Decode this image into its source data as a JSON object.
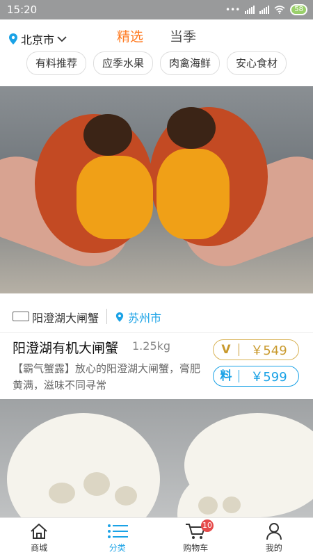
{
  "status_bar": {
    "time": "15:20",
    "battery": "58"
  },
  "header": {
    "city": "北京市",
    "tabs": [
      {
        "label": "精选",
        "active": true
      },
      {
        "label": "当季",
        "active": false
      }
    ]
  },
  "categories": [
    "有料推荐",
    "应季水果",
    "肉禽海鲜",
    "安心食材"
  ],
  "product": {
    "shop_name": "阳澄湖大闸蟹",
    "location": "苏州市",
    "title": "阳澄湖有机大闸蟹",
    "weight": "1.25kg",
    "description": "【霸气蟹露】放心的阳澄湖大闸蟹，膏肥黄满，滋味不同寻常",
    "price_vip_tag": "V",
    "price_vip": "￥549",
    "price_normal_tag": "料",
    "price_normal": "￥599"
  },
  "bottom_nav": [
    {
      "label": "商城",
      "icon": "home-icon"
    },
    {
      "label": "分类",
      "icon": "category-list-icon",
      "active": true
    },
    {
      "label": "购物车",
      "icon": "cart-icon",
      "badge": "10"
    },
    {
      "label": "我的",
      "icon": "user-icon"
    }
  ],
  "colors": {
    "accent_orange": "#ff7a21",
    "accent_blue": "#1aa2e6",
    "gold": "#c99a2e",
    "badge_red": "#e64b4b"
  }
}
